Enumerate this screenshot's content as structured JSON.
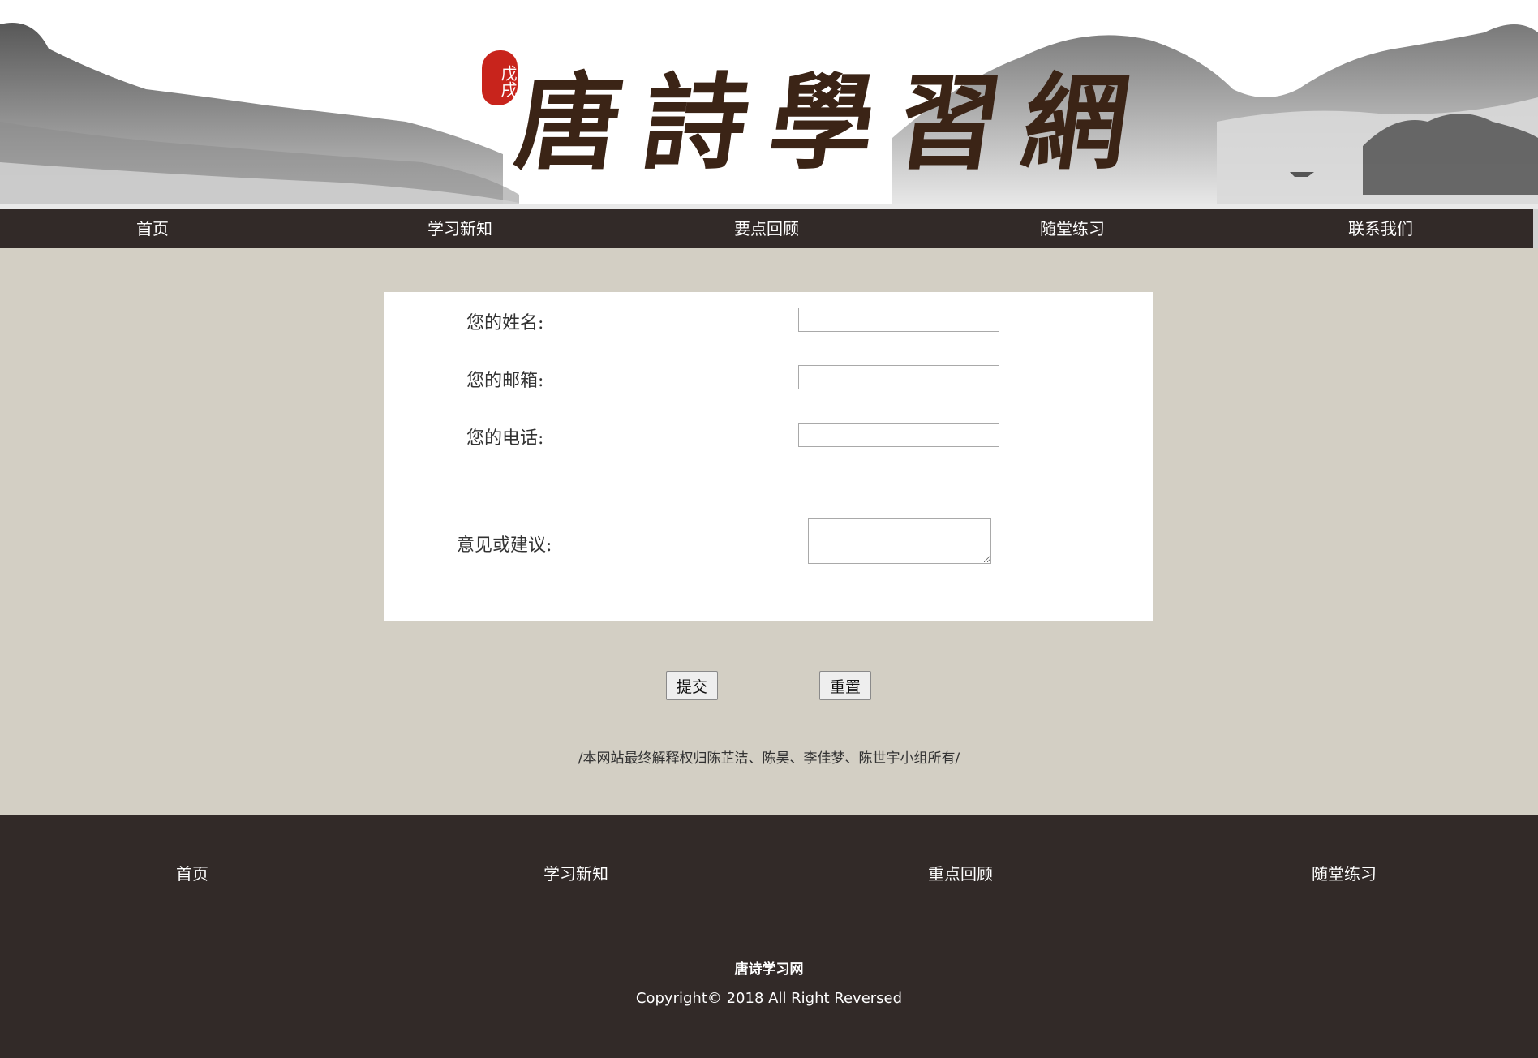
{
  "banner": {
    "seal_text": "戊戌",
    "logo_text": "唐詩學習網"
  },
  "top_nav": {
    "items": [
      "首页",
      "学习新知",
      "要点回顾",
      "随堂练习",
      "联系我们"
    ]
  },
  "form": {
    "name_label": "您的姓名:",
    "name_value": "",
    "email_label": "您的邮箱:",
    "email_value": "",
    "phone_label": "您的电话:",
    "phone_value": "",
    "feedback_label": "意见或建议:",
    "feedback_value": ""
  },
  "buttons": {
    "submit_label": "提交",
    "reset_label": "重置"
  },
  "rights_note": "/本网站最终解释权归陈芷洁、陈昊、李佳梦、陈世宇小组所有/",
  "footer": {
    "nav": [
      "首页",
      "学习新知",
      "重点回顾",
      "随堂练习"
    ],
    "site_name": "唐诗学习网",
    "copyright": "Copyright© 2018 All Right Reversed"
  },
  "colors": {
    "nav_bg": "#322a28",
    "page_bg": "#d3cfc4",
    "seal_red": "#c8241c",
    "logo_ink": "#3b2416"
  }
}
